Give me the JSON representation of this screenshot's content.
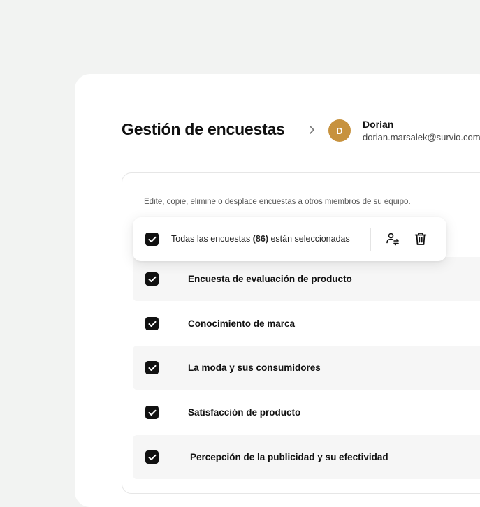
{
  "header": {
    "title": "Gestión de encuestas",
    "user": {
      "initial": "D",
      "name": "Dorian",
      "email": "dorian.marsalek@survio.com"
    }
  },
  "panel": {
    "description": "Edite, copie, elimine o desplace encuestas a otros miembros de su equipo."
  },
  "selection": {
    "text_before": "Todas las encuestas ",
    "count": "(86)",
    "text_after": " están seleccionadas",
    "checked": true
  },
  "surveys": [
    {
      "label": "Encuesta de evaluación de producto",
      "checked": true
    },
    {
      "label": "Conocimiento de marca",
      "checked": true
    },
    {
      "label": "La moda y sus consumidores",
      "checked": true
    },
    {
      "label": "Satisfacción de producto",
      "checked": true
    },
    {
      "label": "Percepción de la publicidad y su efectividad",
      "checked": true
    }
  ],
  "icons": {
    "breadcrumb": "chevron-right-icon",
    "move": "user-transfer-icon",
    "delete": "trash-icon",
    "checkbox": "check-icon"
  },
  "colors": {
    "background": "#f2f3f2",
    "card": "#ffffff",
    "avatar": "#c7923e",
    "checkbox": "#111111",
    "row_shaded": "#f6f6f6"
  }
}
